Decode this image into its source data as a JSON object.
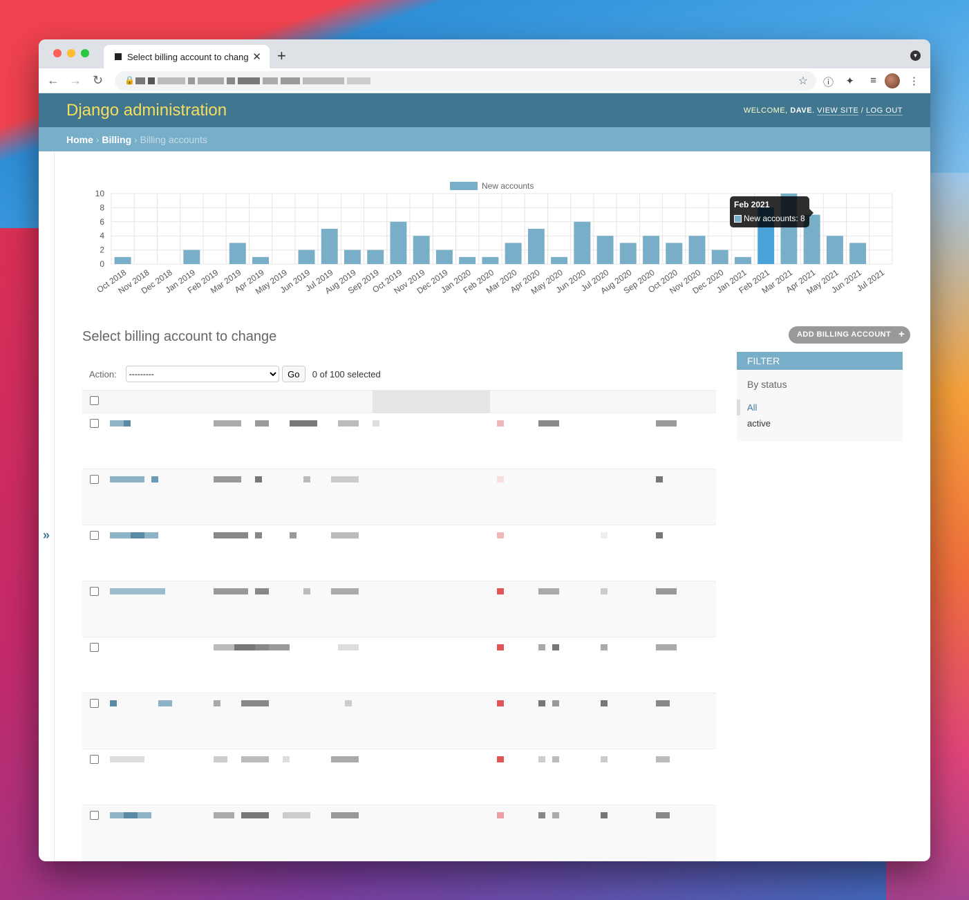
{
  "browser": {
    "tab_title": "Select billing account to change",
    "tab_close": "✕",
    "new_tab": "+"
  },
  "header": {
    "brand": "Django administration",
    "welcome": "WELCOME,",
    "user": "DAVE",
    "view_site": "VIEW SITE",
    "sep": "/",
    "logout": "LOG OUT"
  },
  "breadcrumbs": {
    "home": "Home",
    "billing": "Billing",
    "current": "Billing accounts"
  },
  "chart_data": {
    "type": "bar",
    "legend": [
      "New accounts"
    ],
    "categories": [
      "Oct 2018",
      "Nov 2018",
      "Dec 2018",
      "Jan 2019",
      "Feb 2019",
      "Mar 2019",
      "Apr 2019",
      "May 2019",
      "Jun 2019",
      "Jul 2019",
      "Aug 2019",
      "Sep 2019",
      "Oct 2019",
      "Nov 2019",
      "Dec 2019",
      "Jan 2020",
      "Feb 2020",
      "Mar 2020",
      "Apr 2020",
      "May 2020",
      "Jun 2020",
      "Jul 2020",
      "Aug 2020",
      "Sep 2020",
      "Oct 2020",
      "Nov 2020",
      "Dec 2020",
      "Jan 2021",
      "Feb 2021",
      "Mar 2021",
      "Apr 2021",
      "May 2021",
      "Jun 2021",
      "Jul 2021"
    ],
    "series": [
      {
        "name": "New accounts",
        "values": [
          1,
          0,
          0,
          2,
          0,
          3,
          1,
          0,
          2,
          5,
          2,
          2,
          6,
          4,
          2,
          1,
          1,
          3,
          5,
          1,
          6,
          4,
          3,
          4,
          3,
          4,
          2,
          1,
          8,
          10,
          7,
          4,
          3,
          0
        ]
      }
    ],
    "yticks": [
      "10",
      "8",
      "6",
      "4",
      "2",
      "0"
    ],
    "ylim": [
      0,
      10
    ],
    "legend_position": "top",
    "highlight_index": 28,
    "bar_color": "#79aec8",
    "highlight_color": "#4aa3d8",
    "tooltip": {
      "title": "Feb 2021",
      "label": "New accounts: 8"
    }
  },
  "main": {
    "title": "Select billing account to change",
    "add_button": "ADD BILLING ACCOUNT",
    "add_icon": "+",
    "action_label": "Action:",
    "action_value": "---------",
    "go": "Go",
    "selected_count": "0 of 100 selected",
    "sidebar_toggle": "»"
  },
  "filter": {
    "title": "FILTER",
    "section": "By status",
    "options": [
      "All",
      "active"
    ]
  }
}
